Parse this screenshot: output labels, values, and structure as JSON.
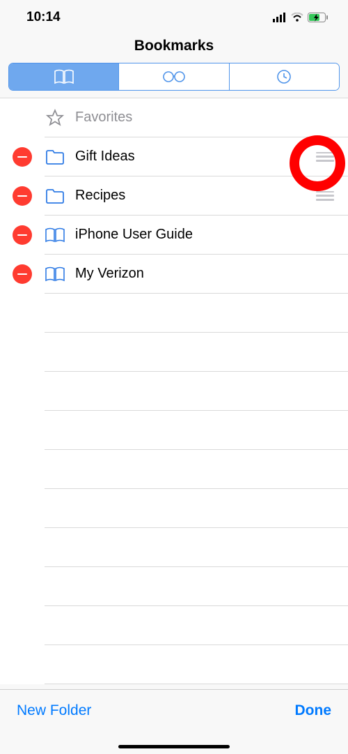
{
  "status": {
    "time": "10:14"
  },
  "header": {
    "title": "Bookmarks"
  },
  "tabs": [
    "bookmarks",
    "reading-list",
    "history"
  ],
  "rows": {
    "favorites": "Favorites",
    "r1": "Gift Ideas",
    "r2": "Recipes",
    "r3": "iPhone User Guide",
    "r4": "My Verizon"
  },
  "footer": {
    "left": "New Folder",
    "right": "Done"
  }
}
